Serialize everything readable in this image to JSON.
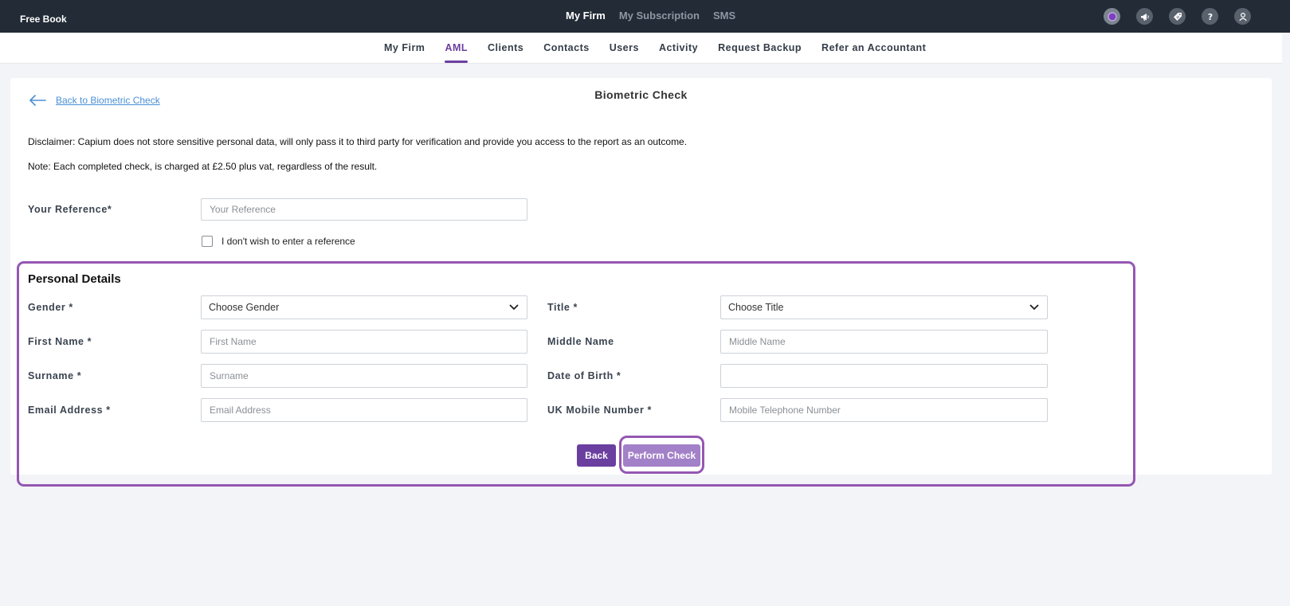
{
  "app": {
    "brand": "Free Book"
  },
  "top_nav": {
    "items": [
      "My Firm",
      "My Subscription",
      "SMS"
    ],
    "active": "My Firm"
  },
  "top_icons": [
    "app-logo-icon",
    "megaphone-icon",
    "tag-icon",
    "help-icon",
    "user-icon"
  ],
  "sub_nav": {
    "items": [
      "My Firm",
      "AML",
      "Clients",
      "Contacts",
      "Users",
      "Activity",
      "Request Backup",
      "Refer an Accountant"
    ],
    "active": "AML"
  },
  "page": {
    "title": "Biometric Check",
    "back_link": "Back to Biometric Check",
    "disclaimer": "Disclaimer: Capium does not store sensitive personal data, will only pass it to third party for verification and provide you access to the report as an outcome.",
    "note": "Note: Each completed check, is charged at £2.50 plus vat, regardless of the result."
  },
  "reference": {
    "label": "Your Reference*",
    "placeholder": "Your Reference",
    "value": "",
    "checkbox_label": "I don't wish to enter a reference",
    "checked": false
  },
  "personal": {
    "heading": "Personal Details",
    "gender": {
      "label": "Gender *",
      "value": "Choose Gender"
    },
    "title": {
      "label": "Title *",
      "value": "Choose Title"
    },
    "first_name": {
      "label": "First Name *",
      "placeholder": "First Name",
      "value": ""
    },
    "middle_name": {
      "label": "Middle Name",
      "placeholder": "Middle Name",
      "value": ""
    },
    "surname": {
      "label": "Surname *",
      "placeholder": "Surname",
      "value": ""
    },
    "dob": {
      "label": "Date of Birth *",
      "placeholder": "",
      "value": ""
    },
    "email": {
      "label": "Email Address *",
      "placeholder": "Email Address",
      "value": ""
    },
    "mobile": {
      "label": "UK Mobile Number *",
      "placeholder": "Mobile Telephone Number",
      "value": ""
    }
  },
  "buttons": {
    "back": "Back",
    "perform": "Perform Check"
  },
  "colors": {
    "topbar": "#222b36",
    "accent": "#6b3fa0",
    "highlight_outline": "#9557b3",
    "link": "#4a8fd6",
    "perform_button": "#a381c8"
  }
}
